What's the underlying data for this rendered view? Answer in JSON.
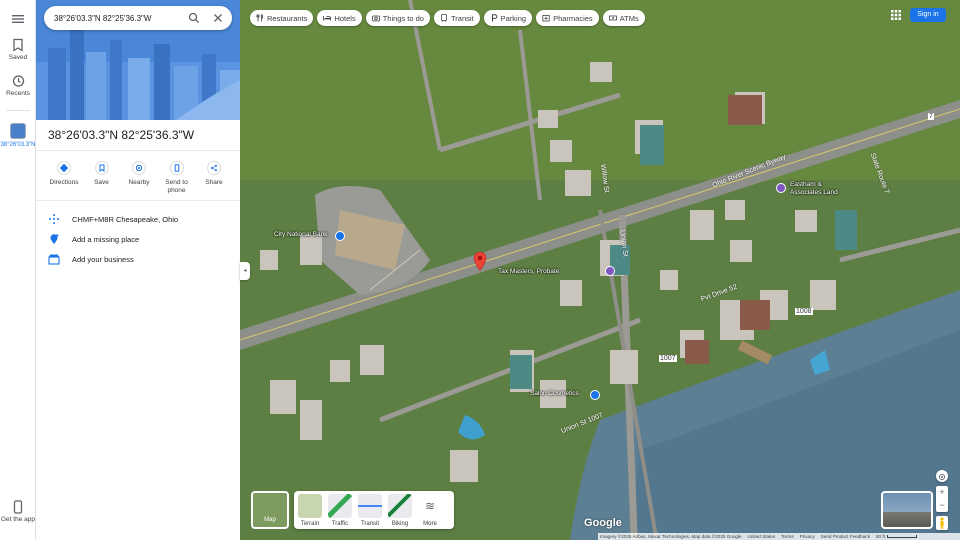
{
  "search": {
    "value": "38°26'03.3\"N 82°25'36.3\"W"
  },
  "rail": {
    "menu_icon": "hamburger-icon",
    "saved_label": "Saved",
    "recents_label": "Recents",
    "place_label": "38°26'03.3\"N",
    "get_app_label": "Get the app"
  },
  "place": {
    "title": "38°26'03.3\"N 82°25'36.3\"W",
    "actions": [
      {
        "label": "Directions",
        "icon": "directions-icon"
      },
      {
        "label": "Save",
        "icon": "bookmark-icon"
      },
      {
        "label": "Nearby",
        "icon": "nearby-icon"
      },
      {
        "label": "Send to phone",
        "icon": "phone-icon"
      },
      {
        "label": "Share",
        "icon": "share-icon"
      }
    ],
    "rows": [
      {
        "text": "CHMF+M8R Chesapeake, Ohio",
        "icon": "plus-code-icon"
      },
      {
        "text": "Add a missing place",
        "icon": "add-place-icon"
      },
      {
        "text": "Add your business",
        "icon": "business-icon"
      }
    ]
  },
  "chips": [
    {
      "label": "Restaurants",
      "icon": "restaurant-icon"
    },
    {
      "label": "Hotels",
      "icon": "hotel-icon"
    },
    {
      "label": "Things to do",
      "icon": "camera-icon"
    },
    {
      "label": "Transit",
      "icon": "transit-icon"
    },
    {
      "label": "Parking",
      "icon": "parking-icon"
    },
    {
      "label": "Pharmacies",
      "icon": "pharmacy-icon"
    },
    {
      "label": "ATMs",
      "icon": "atm-icon"
    }
  ],
  "header": {
    "sign_in": "Sign in"
  },
  "map_labels": {
    "city_national_bank": "City National Bank",
    "tax_masters": "Tax Masters, Probate",
    "eastham": "Eastham &",
    "eastham2": "Associates Land",
    "salon": "Salon Cosmetics",
    "ohio_river_byway": "Ohio River Scenic Byway",
    "state_route_7": "State Route 7",
    "pvt_drive": "Pvt Drive 52",
    "union_st": "Union St",
    "union_st_1007": "Union St 1007",
    "willow": "Willow St",
    "route_1008": "1008",
    "route_1007": "1007",
    "route_7": "7"
  },
  "layers": {
    "main_label": "Map",
    "items": [
      "Terrain",
      "Traffic",
      "Transit",
      "Biking",
      "More"
    ]
  },
  "footer": {
    "logo": "Google",
    "imagery": "Imagery ©2025 Airbus, Maxar Technologies, Map data ©2025 Google",
    "country": "United States",
    "terms": "Terms",
    "privacy": "Privacy",
    "feedback": "Send Product Feedback",
    "scale": "50 ft"
  },
  "colors": {
    "accent": "#1a73e8",
    "pin": "#ea4335",
    "hero": "#4b87d8"
  }
}
